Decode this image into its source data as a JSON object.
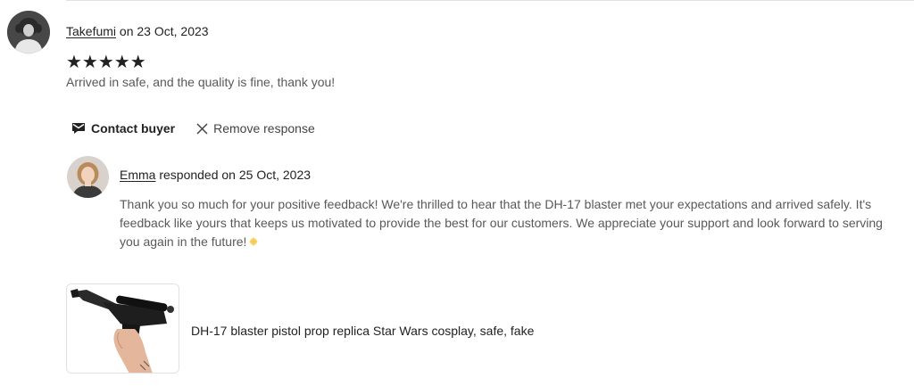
{
  "review": {
    "reviewer_name": "Takefumi",
    "date_text": "on 23 Oct, 2023",
    "rating": 5,
    "stars": "★★★★★",
    "text": "Arrived in safe, and the quality is fine, thank you!"
  },
  "actions": {
    "contact_label": "Contact buyer",
    "remove_label": "Remove response"
  },
  "response": {
    "responder_name": "Emma",
    "date_text": "responded on 25 Oct, 2023",
    "text": "Thank you so much for your positive feedback! We're thrilled to hear that the DH-17 blaster met your expectations and arrived safely. It's feedback like yours that keeps us motivated to provide the best for our customers. We appreciate your support and look forward to serving you again in the future!"
  },
  "listing": {
    "title": "DH-17 blaster pistol prop replica Star Wars cosplay, safe, fake"
  },
  "icons": {
    "reviewer_avatar": "avatar-photo-icon",
    "responder_avatar": "avatar-photo-icon",
    "contact": "envelope-icon",
    "remove": "close-icon",
    "emoji": "sparkle-emoji-icon"
  }
}
